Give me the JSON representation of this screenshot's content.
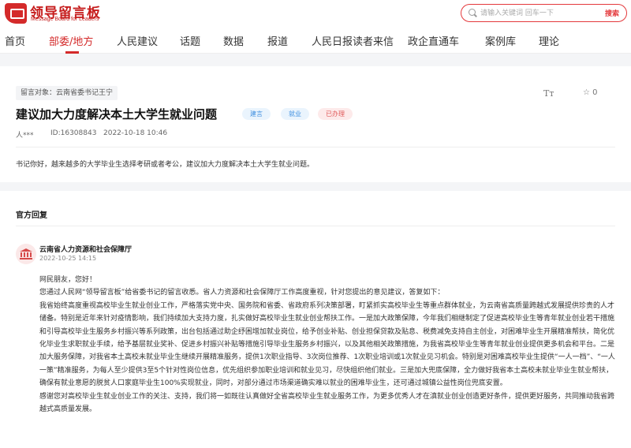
{
  "header": {
    "logo_title": "领导留言板",
    "logo_subtitle": "Message Board for Leaders",
    "search_placeholder": "请输入关键词 回车一下",
    "search_button": "搜索"
  },
  "nav": {
    "items": [
      "首页",
      "部委/地方",
      "人民建议",
      "话题",
      "数据",
      "报道",
      "人民日报读者来信",
      "政企直通车",
      "案例库",
      "理论"
    ],
    "active_index": 1
  },
  "message": {
    "target": "留言对象：云南省委书记王宁",
    "title": "建议加大力度解决本土大学生就业问题",
    "tags": [
      "建言",
      "就业",
      "已办理"
    ],
    "author": "人***",
    "id": "ID:16308843",
    "time": "2022-10-18 10:46",
    "font_toggle": "Tт",
    "like_icon": "☆",
    "like_count": "0",
    "content": "书记你好，越来越多的大学毕业生选择考研或者考公，建议加大力度解决本土大学生就业问题。"
  },
  "reply": {
    "heading": "官方回复",
    "org": "云南省人力资源和社会保障厅",
    "time": "2022-10-25 14:15",
    "paragraphs": [
      "网民朋友，您好！",
      "您通过人民网“领导留言板”给省委书记的留言收悉。省人力资源和社会保障厅工作高度重视，针对您提出的意见建议，答复如下：",
      "我省始终高度重视高校毕业生就业创业工作，严格落实党中央、国务院和省委、省政府系列决策部署，盯紧抓实高校毕业生等重点群体就业，为云南省高质量跨越式发展提供珍贵的人才储备。特别是近年来针对疫情影响，我们持续加大支持力度，扎实做好高校毕业生就业创业帮扶工作。一是加大政策保障，今年我们相继制定了促进高校毕业生等青年就业创业若干措施和引导高校毕业生服务乡村振兴等系列政策，出台包括通过助企纾困增加就业岗位，给予创业补贴、创业担保贷款及贴息、税费减免支持自主创业，对困难毕业生开展精准帮扶，简化优化毕业生求职就业手续，给予基层就业奖补、促进乡村振兴补贴等措施引导毕业生服务乡村振兴，以及其他相关政策措施，为我省高校毕业生等青年就业创业提供更多机会和平台。二是加大服务保障，对我省本土高校未就业毕业生继续开展精准服务，提供1次职业指导、3次岗位推荐、1次职业培训或1次就业见习机会。特别是对困难高校毕业生提供“一人一档”、“一人一策”精准服务，为每人至少提供3至5个针对性岗位信息，优先组织参加职业培训和就业见习，尽快组织他们就业。三是加大兜底保障，全力做好我省本土高校未就业毕业生就业帮扶，确保有就业意愿的脱贫人口家庭毕业生100%实现就业，同时，对部分通过市场渠道确实难以就业的困难毕业生，还可通过城镇公益性岗位兜底安置。",
      "感谢您对高校毕业生就业创业工作的关注、支持，我们将一如既往认真做好全省高校毕业生就业服务工作，为更多优秀人才在滇就业创业创造更好条件，提供更好服务，共同推动我省跨越式高质量发展。"
    ]
  },
  "colors": {
    "brand_red": "#d42a2a",
    "tag_blue": "#3d8ee0",
    "tag_done": "#e05b5b"
  }
}
